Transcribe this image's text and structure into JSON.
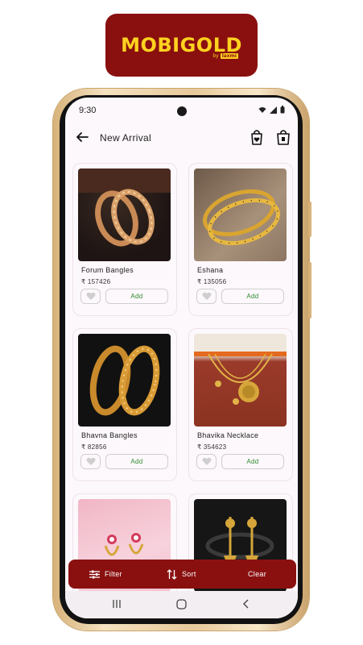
{
  "brand": {
    "name": "MOBIGOLD",
    "by_text": "by",
    "by_brand": "laxmi",
    "primary_color": "#8a1010",
    "accent_color": "#ffd21f"
  },
  "status_bar": {
    "time": "9:30",
    "icons": [
      "wifi-icon",
      "signal-icon",
      "battery-icon"
    ]
  },
  "header": {
    "back_icon": "arrow-left-icon",
    "title": "New Arrival",
    "wishlist_icon": "heart-bag-icon",
    "cart_icon": "shopping-bag-icon"
  },
  "products": [
    {
      "name": "Forum Bangles",
      "price": "₹ 157426",
      "add_label": "Add"
    },
    {
      "name": "Eshana",
      "price": "₹ 135056",
      "add_label": "Add"
    },
    {
      "name": "Bhavna Bangles",
      "price": "₹ 82856",
      "add_label": "Add"
    },
    {
      "name": "Bhavika Necklace",
      "price": "₹ 354623",
      "add_label": "Add"
    },
    {
      "name": "",
      "price": "",
      "add_label": ""
    },
    {
      "name": "",
      "price": "",
      "add_label": ""
    }
  ],
  "action_bar": {
    "filter_label": "Filter",
    "sort_label": "Sort",
    "clear_label": "Clear"
  },
  "nav": {
    "icons": [
      "recents-icon",
      "home-icon",
      "back-icon"
    ]
  }
}
